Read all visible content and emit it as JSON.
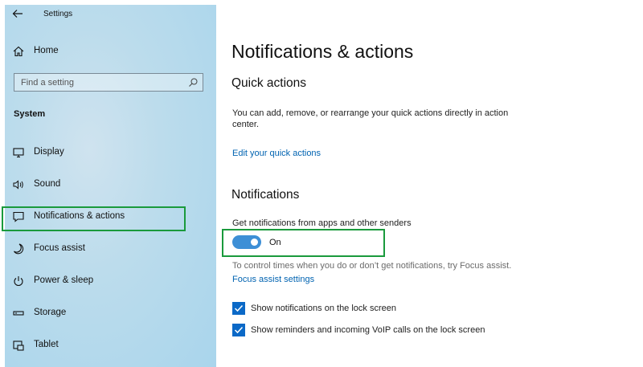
{
  "window": {
    "title": "Settings"
  },
  "sidebar": {
    "home": "Home",
    "search_placeholder": "Find a setting",
    "section": "System",
    "items": [
      {
        "label": "Display",
        "icon": "monitor-icon"
      },
      {
        "label": "Sound",
        "icon": "speaker-icon"
      },
      {
        "label": "Notifications & actions",
        "icon": "message-icon"
      },
      {
        "label": "Focus assist",
        "icon": "moon-icon"
      },
      {
        "label": "Power & sleep",
        "icon": "power-icon"
      },
      {
        "label": "Storage",
        "icon": "storage-icon"
      },
      {
        "label": "Tablet",
        "icon": "tablet-icon"
      }
    ]
  },
  "main": {
    "title": "Notifications & actions",
    "quick_actions": {
      "heading": "Quick actions",
      "desc_line1": "You can add, remove, or rearrange your quick actions directly in action",
      "desc_line2": "center.",
      "link": "Edit your quick actions"
    },
    "notifications": {
      "heading": "Notifications",
      "get_label": "Get notifications from apps and other senders",
      "toggle_state": "On",
      "focus_text": "To control times when you do or don’t get notifications, try Focus assist.",
      "focus_link": "Focus assist settings",
      "checkboxes": [
        {
          "label": "Show notifications on the lock screen",
          "checked": true
        },
        {
          "label": "Show reminders and incoming VoIP calls on the lock screen",
          "checked": true
        }
      ]
    }
  },
  "colors": {
    "accent": "#0063b1",
    "toggle": "#3d8fd6",
    "highlight": "#1a9a3c"
  }
}
